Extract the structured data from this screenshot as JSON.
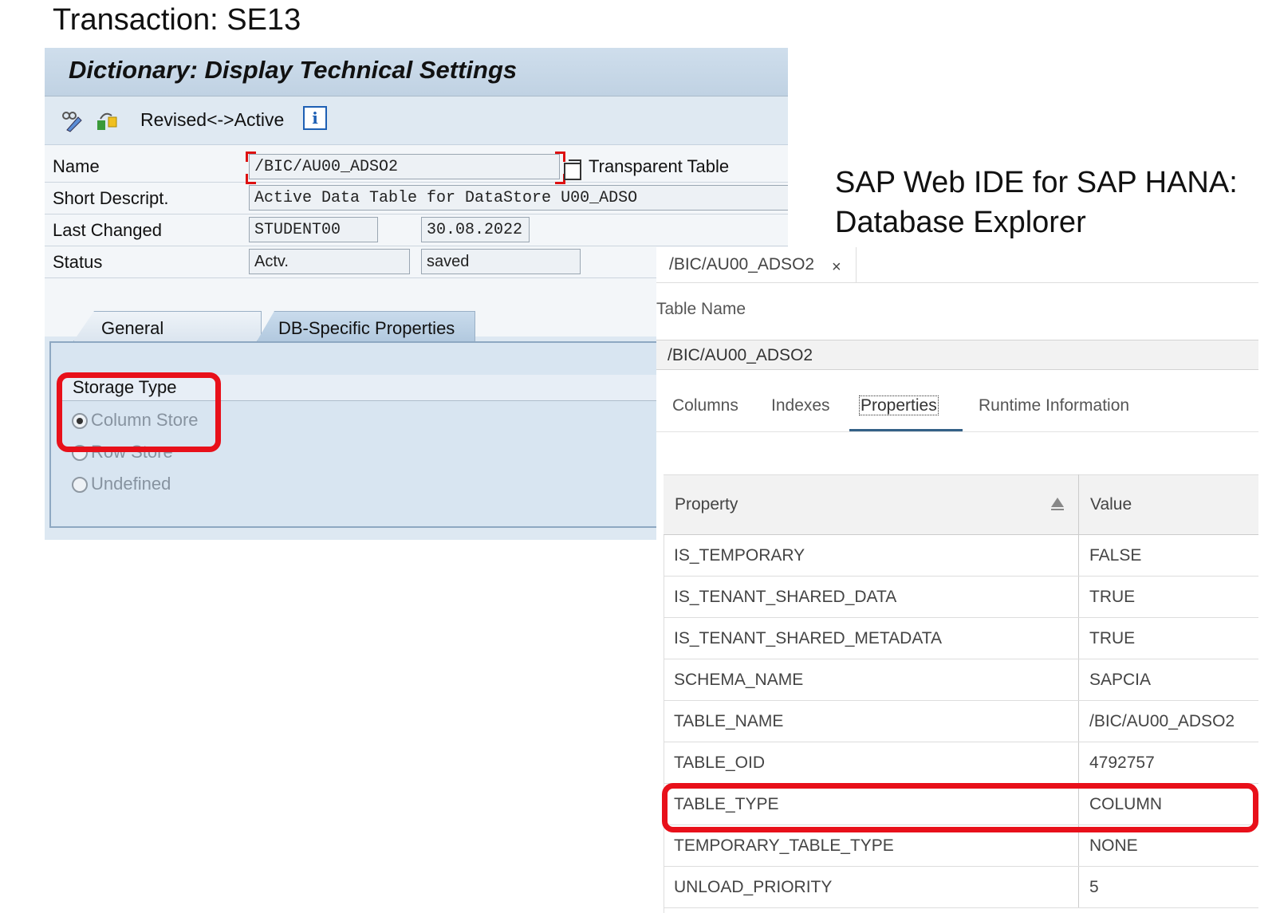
{
  "captions": {
    "transaction": "Transaction:  SE13",
    "web_ide_line1": "SAP Web IDE for SAP HANA:",
    "web_ide_line2": "Database Explorer"
  },
  "sap_gui": {
    "title": "Dictionary: Display Technical Settings",
    "toolbar": {
      "icons": [
        "display-change-icon",
        "active-revised-toggle-icon",
        "info-icon"
      ],
      "revised_active_label": "Revised<->Active",
      "info_glyph": "i"
    },
    "fields": {
      "name_label": "Name",
      "name_value": "/BIC/AU00_ADSO2",
      "object_type": "Transparent Table",
      "short_descr_label": "Short Descript.",
      "short_descr_value": "Active Data Table for DataStore U00_ADSO",
      "last_changed_label": "Last Changed",
      "last_changed_user": "STUDENT00",
      "last_changed_date": "30.08.2022",
      "status_label": "Status",
      "status_value": "Actv.",
      "status_state": "saved"
    },
    "tabs": {
      "general": "General Properties",
      "db_specific": "DB-Specific Properties",
      "active": "db_specific"
    },
    "storage_type": {
      "header": "Storage Type",
      "options": [
        "Column Store",
        "Row Store",
        "Undefined"
      ],
      "selected": "Column Store"
    },
    "colors": {
      "highlight": "#e8101a",
      "title_bg": "#c6d6e6"
    }
  },
  "web_ide": {
    "tab_label": "/BIC/AU00_ADSO2",
    "tab_close": "×",
    "table_name_label": "Table Name",
    "table_name_value": "/BIC/AU00_ADSO2",
    "tabs": [
      "Columns",
      "Indexes",
      "Properties",
      "Runtime Information"
    ],
    "active_tab": "Properties",
    "table": {
      "headers": [
        "Property",
        "Value"
      ],
      "rows": [
        [
          "IS_TEMPORARY",
          "FALSE"
        ],
        [
          "IS_TENANT_SHARED_DATA",
          "TRUE"
        ],
        [
          "IS_TENANT_SHARED_METADATA",
          "TRUE"
        ],
        [
          "SCHEMA_NAME",
          "SAPCIA"
        ],
        [
          "TABLE_NAME",
          "/BIC/AU00_ADSO2"
        ],
        [
          "TABLE_OID",
          "4792757"
        ],
        [
          "TABLE_TYPE",
          "COLUMN"
        ],
        [
          "TEMPORARY_TABLE_TYPE",
          "NONE"
        ],
        [
          "UNLOAD_PRIORITY",
          "5"
        ]
      ],
      "highlighted_row": "TABLE_TYPE"
    }
  }
}
